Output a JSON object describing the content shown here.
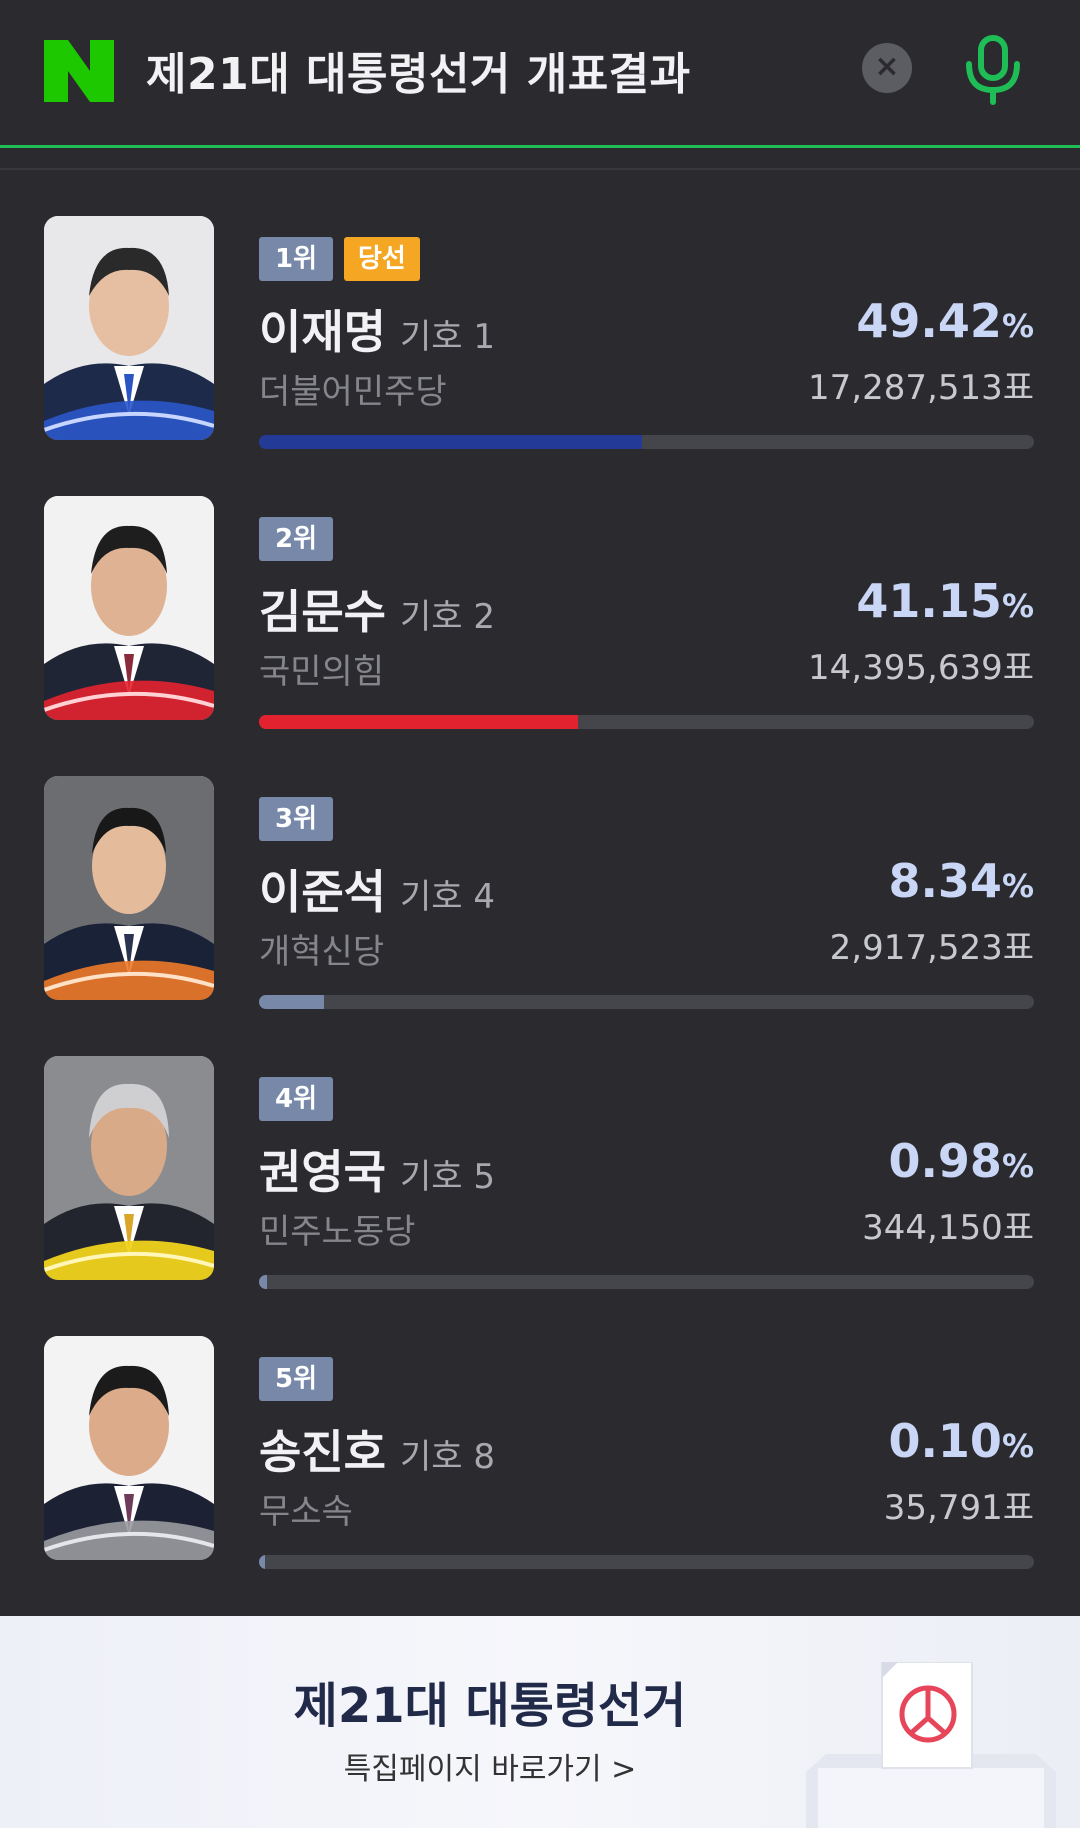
{
  "header": {
    "title": "제21대 대통령선거 개표결과",
    "close_label": "×",
    "accent": "#1fbd55"
  },
  "candidates": [
    {
      "rank": "1위",
      "elected": "당선",
      "name": "이재명",
      "number": "기호 1",
      "party": "더불어민주당",
      "percent": "49.42",
      "percent_unit": "%",
      "votes": "17,287,513표",
      "bar_fraction": 0.4942,
      "color": "#243a97"
    },
    {
      "rank": "2위",
      "name": "김문수",
      "number": "기호 2",
      "party": "국민의힘",
      "percent": "41.15",
      "percent_unit": "%",
      "votes": "14,395,639표",
      "bar_fraction": 0.4115,
      "color": "#e3222f"
    },
    {
      "rank": "3위",
      "name": "이준석",
      "number": "기호 4",
      "party": "개혁신당",
      "percent": "8.34",
      "percent_unit": "%",
      "votes": "2,917,523표",
      "bar_fraction": 0.0834,
      "color": "#7788a8"
    },
    {
      "rank": "4위",
      "name": "권영국",
      "number": "기호 5",
      "party": "민주노동당",
      "percent": "0.98",
      "percent_unit": "%",
      "votes": "344,150표",
      "bar_fraction": 0.0098,
      "color": "#7788a8"
    },
    {
      "rank": "5위",
      "name": "송진호",
      "number": "기호 8",
      "party": "무소속",
      "percent": "0.10",
      "percent_unit": "%",
      "votes": "35,791표",
      "bar_fraction": 0.001,
      "color": "#7788a8"
    }
  ],
  "banner": {
    "title": "제21대 대통령선거",
    "link": "특집페이지 바로가기 >"
  }
}
